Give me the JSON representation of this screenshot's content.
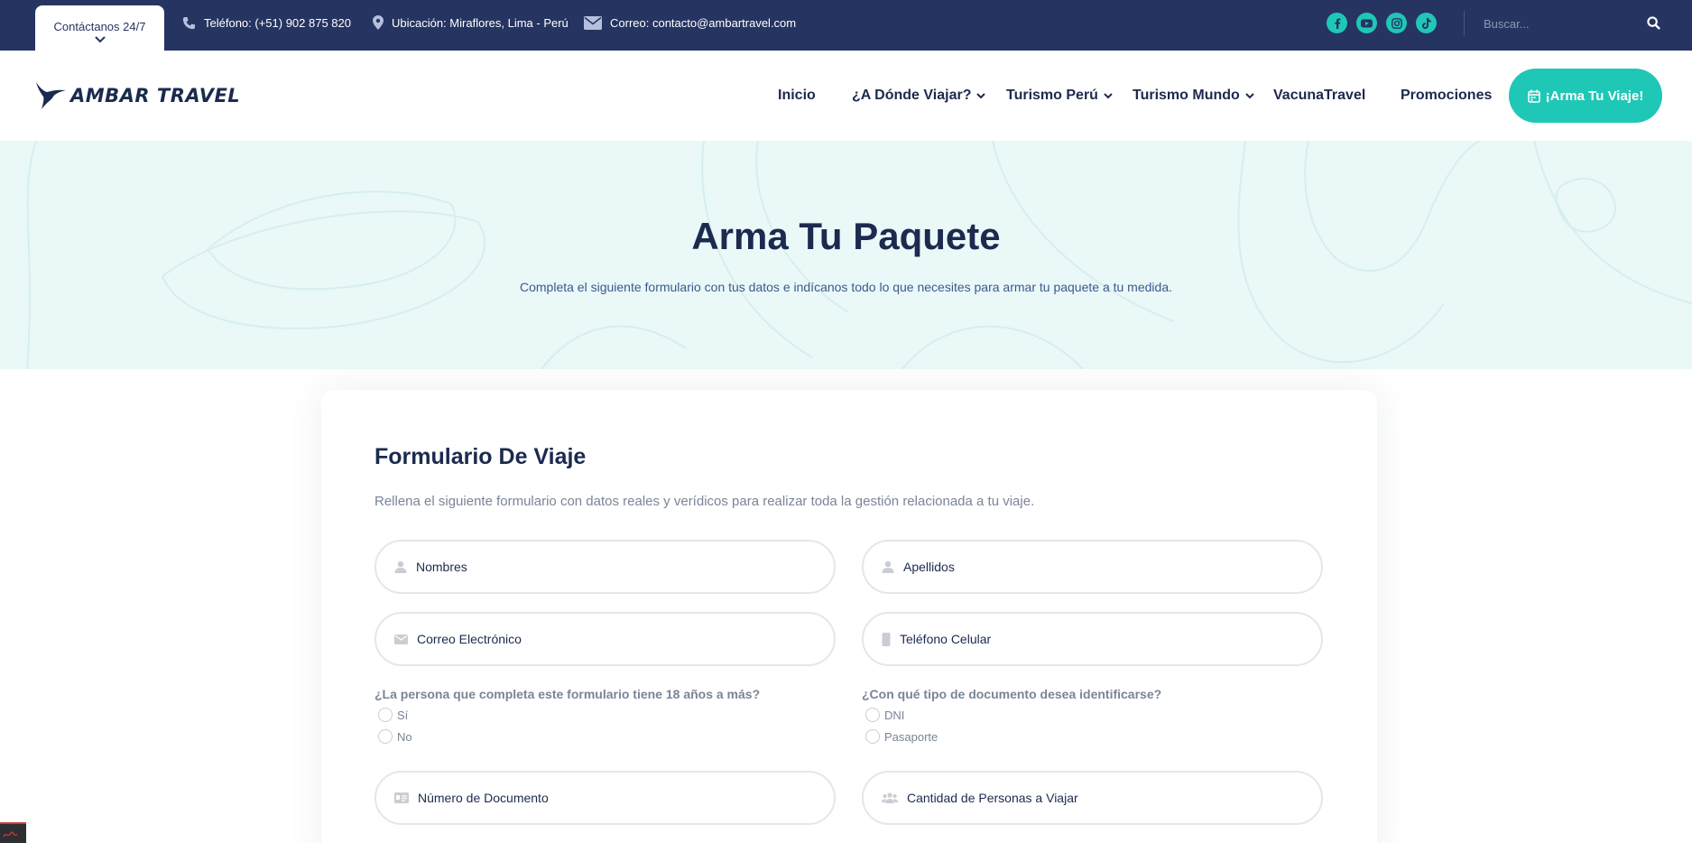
{
  "topbar": {
    "contact_tab": "Contáctanos 24/7",
    "phone": "Teléfono: (+51) 902 875 820",
    "location": "Ubicación: Miraflores, Lima - Perú",
    "email": "Correo: contacto@ambartravel.com",
    "social_icons": [
      "facebook-icon",
      "youtube-icon",
      "instagram-icon",
      "tiktok-icon"
    ],
    "search_placeholder": "Buscar..."
  },
  "header": {
    "logo_text": "AMBAR TRAVEL",
    "nav": {
      "inicio": "Inicio",
      "donde_viajar": "¿A Dónde Viajar?",
      "turismo_peru": "Turismo Perú",
      "turismo_mundo": "Turismo Mundo",
      "vacuna": "VacunaTravel",
      "promociones": "Promociones"
    },
    "cta": "¡Arma Tu Viaje!"
  },
  "hero": {
    "title": "Arma Tu Paquete",
    "subtitle": "Completa el siguiente formulario con tus datos e indícanos todo lo que necesites para armar tu paquete a tu medida."
  },
  "form": {
    "title": "Formulario De Viaje",
    "description": "Rellena el siguiente formulario con datos reales y verídicos para realizar toda la gestión relacionada a tu viaje.",
    "fields": {
      "nombres": "Nombres",
      "apellidos": "Apellidos",
      "correo": "Correo Electrónico",
      "telefono": "Teléfono Celular",
      "documento": "Número de Documento",
      "personas": "Cantidad de Personas a Viajar"
    },
    "q_age": {
      "label": "¿La persona que completa este formulario tiene 18 años a más?",
      "options": [
        "Sí",
        "No"
      ]
    },
    "q_doc": {
      "label": "¿Con qué tipo de documento desea identificarse?",
      "options": [
        "DNI",
        "Pasaporte"
      ]
    }
  },
  "colors": {
    "navy": "#263461",
    "text_dark": "#1b2a4e",
    "accent": "#1fc7b6",
    "hero_bg": "#eaf8f8",
    "muted": "#7a8597"
  }
}
